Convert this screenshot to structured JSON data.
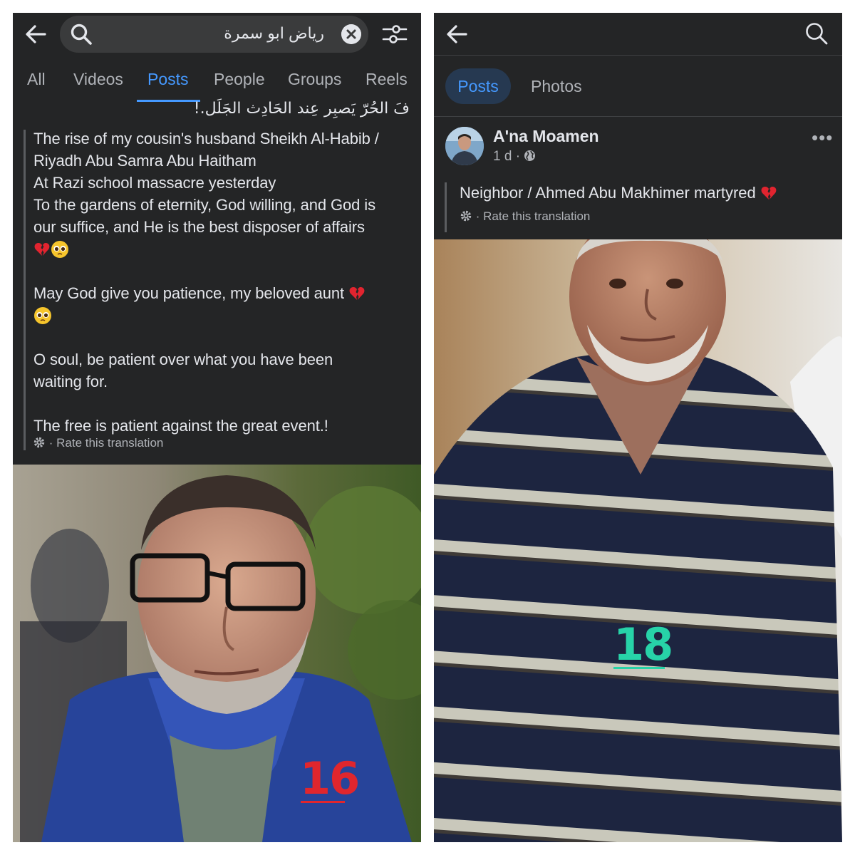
{
  "left": {
    "search": {
      "query": "رياض ابو سمرة"
    },
    "tabs": [
      {
        "label": "All",
        "active": false
      },
      {
        "label": "Videos",
        "active": false
      },
      {
        "label": "Posts",
        "active": true
      },
      {
        "label": "People",
        "active": false
      },
      {
        "label": "Groups",
        "active": false
      },
      {
        "label": "Reels",
        "active": false
      }
    ],
    "post": {
      "original_text": "فَ الحُرّ يَصبِر عِند الحَادِث الجَلَل.!",
      "translation": [
        "The rise of my cousin's husband Sheikh Al-Habib /",
        "Riyadh Abu Samra Abu Haitham",
        "At Razi school massacre yesterday",
        "To the gardens of eternity, God willing, and God is",
        "our suffice, and He is the best disposer of affairs",
        "May God give you patience, my beloved aunt",
        "O soul, be patient over what you have been",
        "waiting for.",
        "The free is patient against the great event.!"
      ],
      "rate_label": "Rate this translation",
      "photo_number": "16"
    }
  },
  "right": {
    "tabs": [
      {
        "label": "Posts",
        "active": true
      },
      {
        "label": "Photos",
        "active": false
      }
    ],
    "post": {
      "author": "A'na Moamen",
      "time": "1 d",
      "translation": "Neighbor / Ahmed Abu Makhimer martyred",
      "rate_label": "Rate this translation",
      "photo_number": "18"
    }
  },
  "colors": {
    "panel_bg": "#242526",
    "accent": "#4599ff",
    "text_primary": "#e4e6eb",
    "text_secondary": "#b0b3b8",
    "label_red": "#e0262d",
    "label_teal": "#27d3a8"
  }
}
